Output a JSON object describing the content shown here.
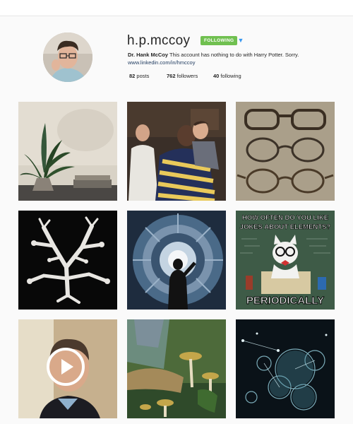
{
  "profile": {
    "username": "h.p.mccoy",
    "follow_label": "FOLLOWING",
    "bio_name": "Dr. Hank McCoy",
    "bio_text": " This account has nothing to do with Harry Potter. Sorry.",
    "link": "www.linkedin.com/in/hmccoy"
  },
  "stats": {
    "posts_count": "82",
    "posts_label": " posts",
    "followers_count": "762",
    "followers_label": " followers",
    "following_count": "40",
    "following_label": " following"
  },
  "posts": {
    "meme_top": "HOW OFTEN DO YOU LIKE",
    "meme_mid": "JOKES ABOUT ELEMENTS?",
    "meme_bottom": "PERIODICALLY"
  },
  "icons": {
    "dropdown": "chevron-down-icon",
    "play": "play-icon"
  },
  "colors": {
    "following_button": "#70c050",
    "dropdown": "#3897f0",
    "link": "#1e3a5f"
  }
}
